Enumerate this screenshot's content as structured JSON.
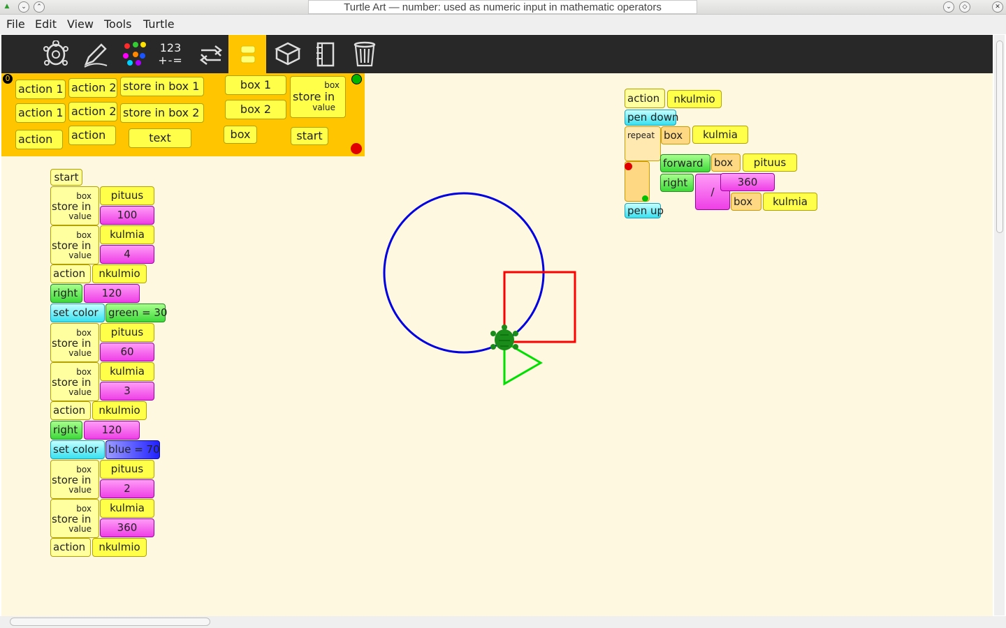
{
  "window": {
    "title": "Turtle Art — number: used as numeric input in mathematic operators",
    "left_buttons": [
      "▲",
      "⌃"
    ],
    "right_buttons": [
      "⌄",
      "◇",
      "✕"
    ]
  },
  "menu": [
    "File",
    "Edit",
    "View",
    "Tools",
    "Turtle"
  ],
  "toolbar": {
    "icons": [
      "turtle-icon",
      "pen-icon",
      "colors-icon",
      "numbers-icon",
      "flow-icon",
      "blocks-icon",
      "extras-icon",
      "sensors-icon",
      "trash-icon"
    ],
    "numbers_label_top": "123",
    "numbers_label_bottom": "+-=",
    "active": "blocks-icon"
  },
  "palette": {
    "r1": [
      "action 1",
      "action 2",
      "store in box 1",
      "box 1"
    ],
    "r2": [
      "action 1",
      "action 2",
      "store in box 2",
      "box 2"
    ],
    "r3": [
      "action",
      "action",
      "text",
      "box",
      "start"
    ],
    "store_box": "box",
    "store_in": "store in",
    "store_value": "value"
  },
  "program": {
    "start": "start",
    "store_in": "store in",
    "box": "box",
    "value": "value",
    "action": "action",
    "right": "right",
    "set_color": "set color",
    "s1_name": "pituus",
    "s1_val": "100",
    "s2_name": "kulmia",
    "s2_val": "4",
    "a1": "nkulmio",
    "r1": "120",
    "c1": "green = 30",
    "s3_name": "pituus",
    "s3_val": "60",
    "s4_name": "kulmia",
    "s4_val": "3",
    "a2": "nkulmio",
    "r2": "120",
    "c2": "blue = 70",
    "s5_name": "pituus",
    "s5_val": "2",
    "s6_name": "kulmia",
    "s6_val": "360",
    "a3": "nkulmio"
  },
  "procedure": {
    "action": "action",
    "name": "nkulmio",
    "pen_down": "pen down",
    "repeat": "repeat",
    "box": "box",
    "repeat_box": "kulmia",
    "forward": "forward",
    "fwd_box": "pituus",
    "right": "right",
    "div": "/",
    "num": "360",
    "div_box": "kulmia",
    "pen_up": "pen up"
  },
  "colors": {
    "circle": "#0000e0",
    "square": "#ff0000",
    "triangle": "#00e000",
    "turtle": "#1a8c1a",
    "canvas": "#fff8e1",
    "palette_bg": "#ffc600",
    "toolbar_bg": "#282828"
  }
}
